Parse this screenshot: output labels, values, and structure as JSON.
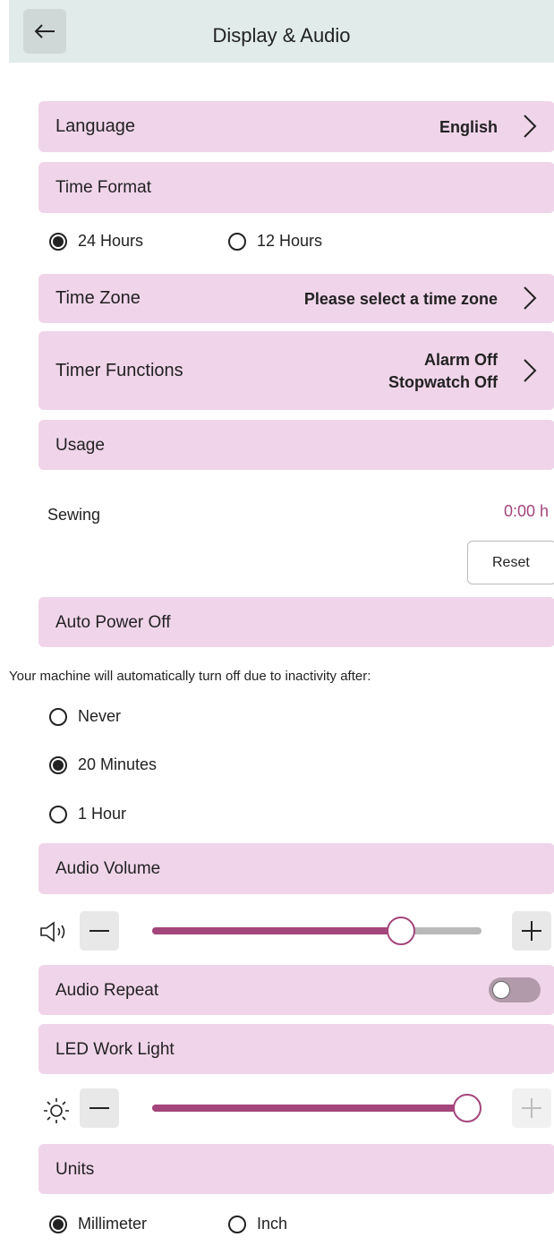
{
  "header": {
    "title": "Display & Audio"
  },
  "language": {
    "label": "Language",
    "value": "English"
  },
  "time_format": {
    "label": "Time Format",
    "options": [
      "24 Hours",
      "12 Hours"
    ],
    "selected": "24 Hours"
  },
  "time_zone": {
    "label": "Time Zone",
    "value": "Please select a time zone"
  },
  "timer_functions": {
    "label": "Timer Functions",
    "alarm": "Alarm Off",
    "stopwatch": "Stopwatch Off"
  },
  "usage": {
    "label": "Usage",
    "sewing_label": "Sewing",
    "sewing_value": "0:00 h",
    "reset_label": "Reset"
  },
  "auto_power_off": {
    "label": "Auto Power Off",
    "description": "Your machine will automatically turn off due to inactivity after:",
    "options": [
      "Never",
      "20 Minutes",
      "1 Hour"
    ],
    "selected": "20 Minutes"
  },
  "audio_volume": {
    "label": "Audio Volume",
    "level": 0.79
  },
  "audio_repeat": {
    "label": "Audio Repeat",
    "enabled": false
  },
  "led_work_light": {
    "label": "LED Work Light",
    "level": 1.0
  },
  "units": {
    "label": "Units",
    "options": [
      "Millimeter",
      "Inch"
    ],
    "selected": "Millimeter"
  },
  "colors": {
    "accent": "#a4457b",
    "row_bg": "#f0d5ea",
    "header_bg": "#e1ebea",
    "value_text": "#a4457b"
  },
  "icons": [
    "back-arrow-icon",
    "chevron-right-icon",
    "speaker-icon",
    "minus-icon",
    "plus-icon",
    "sun-icon"
  ]
}
